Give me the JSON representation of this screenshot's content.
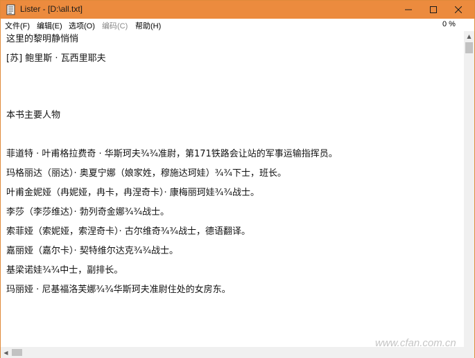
{
  "window": {
    "title": "Lister - [D:\\all.txt]",
    "accent_color": "#ec8b3e"
  },
  "titlebar_buttons": {
    "minimize_icon": "minimize-icon",
    "maximize_icon": "maximize-icon",
    "close_icon": "close-icon"
  },
  "menu": {
    "file": "文件(F)",
    "edit": "编辑(E)",
    "options": "选项(O)",
    "encoding": "编码(C)",
    "help": "帮助(H)",
    "percent": "0 %"
  },
  "content": {
    "lines": [
      "这里的黎明静悄悄",
      "[苏] 鲍里斯 · 瓦西里耶夫",
      "本书主要人物",
      "菲道特 · 叶甫格拉费奇 · 华斯珂夫¾¾准尉，第171铁路会让站的军事运输指挥员。",
      "玛格丽达（丽达）· 奥夏宁娜（娘家姓，穆施达珂娃）¾¾下士，班长。",
      "叶甫金妮娅（冉妮娅，冉卡，冉涅奇卡）· 康梅丽珂娃¾¾战士。",
      "李莎（李莎维达）· 勃列奇金娜¾¾战士。",
      "索菲娅（索妮娅，索涅奇卡）· 古尔维奇¾¾战士，德语翻译。",
      "嘉丽娅（嘉尔卡）· 契特维尔达克¾¾战士。",
      "基梁诺娃¾¾中士，副排长。",
      "玛丽娅 · 尼基福洛芙娜¾¾华斯珂夫准尉住处的女房东。"
    ]
  },
  "watermark": "www.cfan.com.cn"
}
